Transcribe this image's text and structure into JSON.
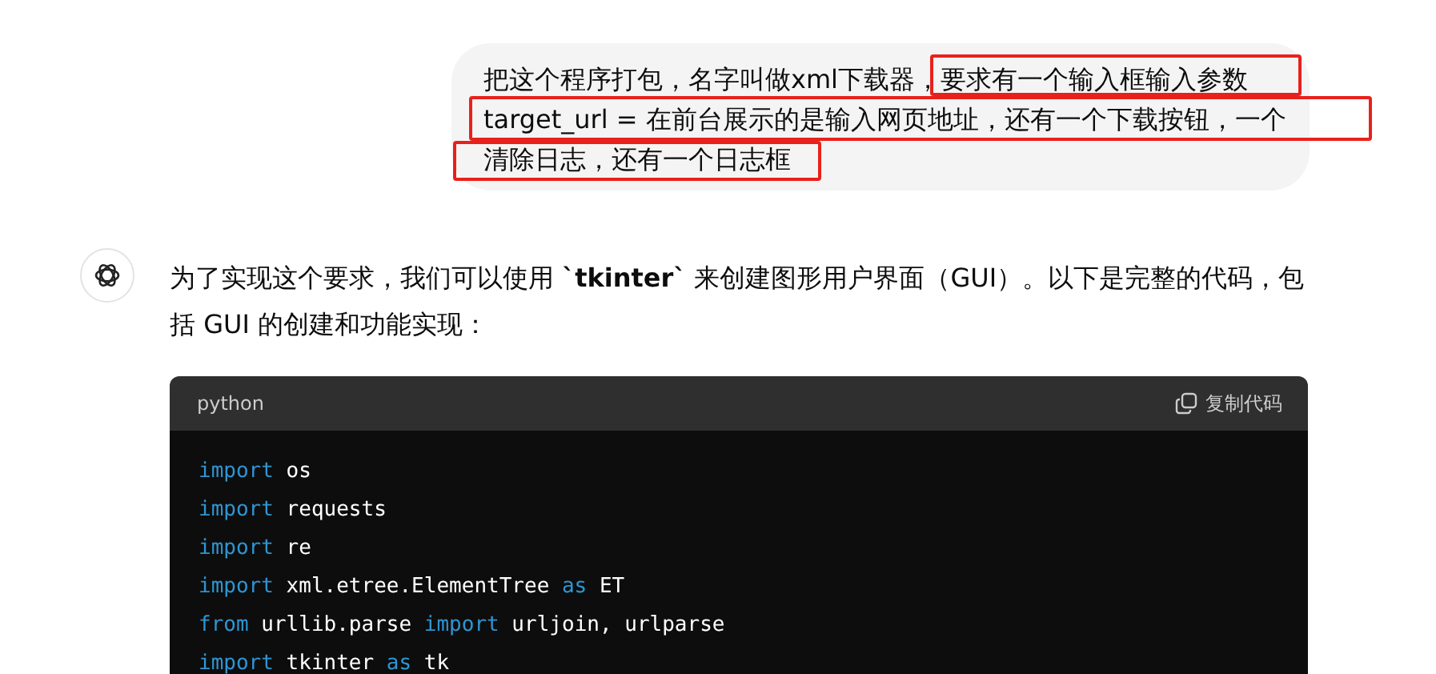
{
  "user_message": {
    "lines": [
      "把这个程序打包，名字叫做xml下载器，要求有一个输入框输入参数",
      "target_url = 在前台展示的是输入网页地址，还有一个下载按钮，一个",
      "清除日志，还有一个日志框"
    ]
  },
  "assistant_message": {
    "lines": [
      "为了实现这个要求，我们可以使用 **`tkinter`** 来创建图形用户界面（GUI）。以下是完整的代码，包",
      "括 GUI 的创建和功能实现："
    ]
  },
  "code_block": {
    "language": "python",
    "copy_label": "复制代码",
    "lines": [
      [
        {
          "kind": "keyword",
          "text": "import"
        },
        {
          "kind": "plain",
          "text": " os"
        }
      ],
      [
        {
          "kind": "keyword",
          "text": "import"
        },
        {
          "kind": "plain",
          "text": " requests"
        }
      ],
      [
        {
          "kind": "keyword",
          "text": "import"
        },
        {
          "kind": "plain",
          "text": " re"
        }
      ],
      [
        {
          "kind": "keyword",
          "text": "import"
        },
        {
          "kind": "plain",
          "text": " xml.etree.ElementTree "
        },
        {
          "kind": "keyword",
          "text": "as"
        },
        {
          "kind": "plain",
          "text": " ET"
        }
      ],
      [
        {
          "kind": "keyword",
          "text": "from"
        },
        {
          "kind": "plain",
          "text": " urllib.parse "
        },
        {
          "kind": "keyword",
          "text": "import"
        },
        {
          "kind": "plain",
          "text": " urljoin, urlparse"
        }
      ],
      [
        {
          "kind": "keyword",
          "text": "import"
        },
        {
          "kind": "plain",
          "text": " tkinter "
        },
        {
          "kind": "keyword",
          "text": "as"
        },
        {
          "kind": "plain",
          "text": " tk"
        }
      ]
    ]
  }
}
